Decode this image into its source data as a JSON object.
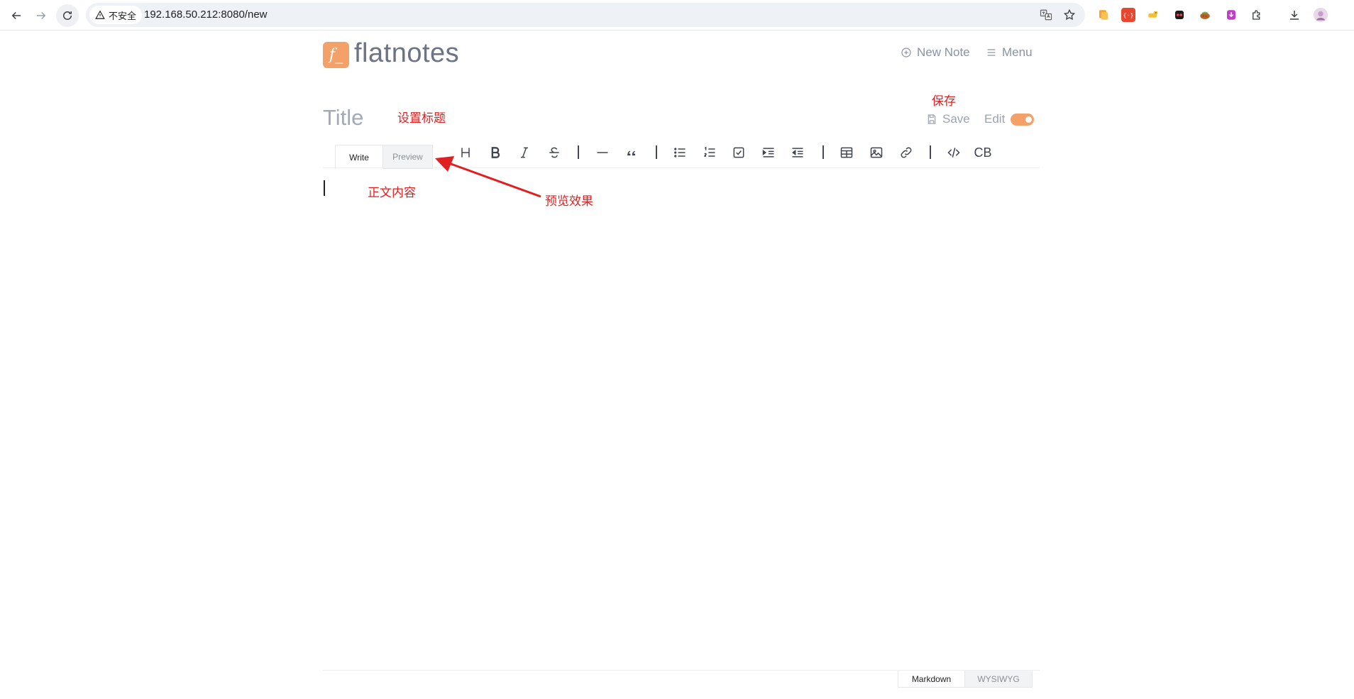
{
  "browser": {
    "security_label": "不安全",
    "url": "192.168.50.212:8080/new"
  },
  "app": {
    "logo_glyph": "f_",
    "name": "flatnotes",
    "new_note_label": "New Note",
    "menu_label": "Menu",
    "accent_color": "#f4a169"
  },
  "note": {
    "title_placeholder": "Title",
    "save_label": "Save",
    "edit_label": "Edit",
    "edit_mode_on": true
  },
  "editor": {
    "tabs": [
      {
        "label": "Write",
        "active": true
      },
      {
        "label": "Preview",
        "active": false
      }
    ],
    "toolbar": [
      {
        "name": "heading",
        "icon": "heading-icon"
      },
      {
        "name": "bold",
        "icon": "bold-icon"
      },
      {
        "name": "italic",
        "icon": "italic-icon"
      },
      {
        "name": "strike",
        "icon": "strikethrough-icon"
      },
      {
        "name": "horizontal-rule",
        "icon": "horizontal-rule-icon"
      },
      {
        "name": "quote",
        "icon": "quote-icon"
      },
      {
        "name": "bullet-list",
        "icon": "bullet-list-icon"
      },
      {
        "name": "ordered-list",
        "icon": "ordered-list-icon"
      },
      {
        "name": "task-list",
        "icon": "task-list-icon"
      },
      {
        "name": "indent",
        "icon": "indent-icon"
      },
      {
        "name": "outdent",
        "icon": "outdent-icon"
      },
      {
        "name": "table",
        "icon": "table-icon"
      },
      {
        "name": "image",
        "icon": "image-icon"
      },
      {
        "name": "link",
        "icon": "link-icon"
      },
      {
        "name": "code",
        "icon": "code-icon"
      },
      {
        "name": "code-block",
        "label": "CB"
      }
    ],
    "modes": [
      {
        "label": "Markdown",
        "active": true
      },
      {
        "label": "WYSIWYG",
        "active": false
      }
    ]
  },
  "annotations": {
    "save": "保存",
    "title": "设置标题",
    "body": "正文内容",
    "preview": "预览效果",
    "color": "#e02020"
  }
}
